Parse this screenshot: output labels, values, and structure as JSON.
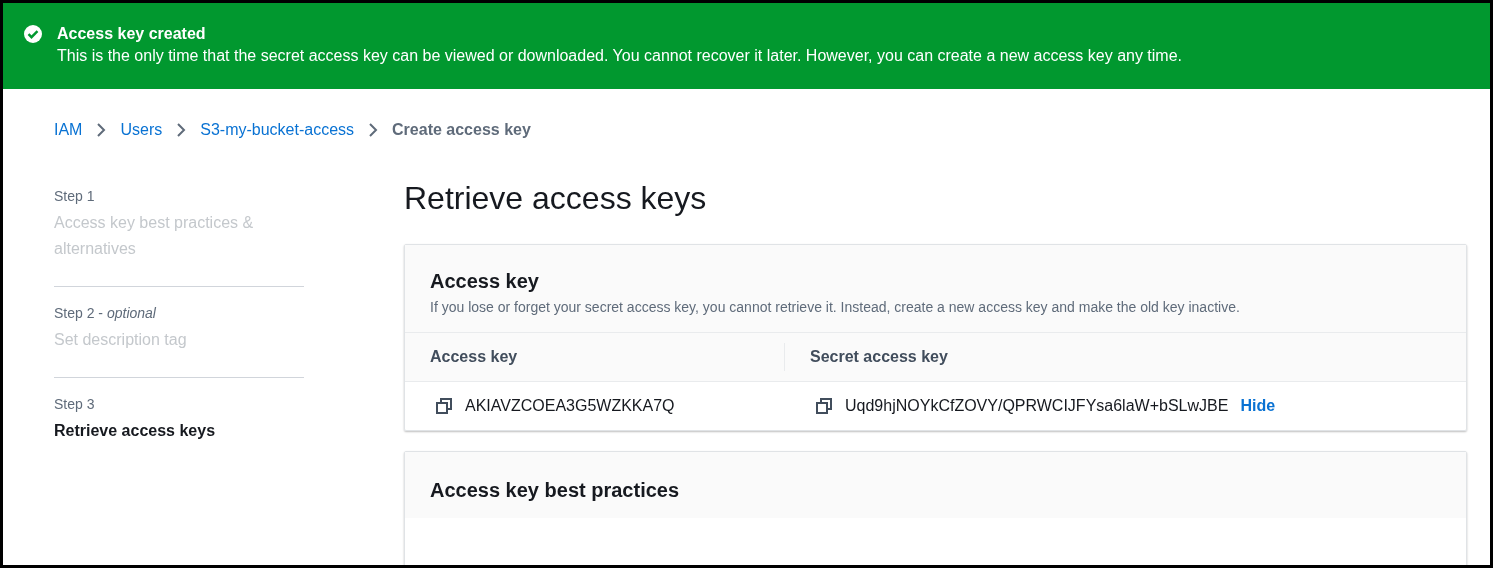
{
  "flash": {
    "title": "Access key created",
    "message": "This is the only time that the secret access key can be viewed or downloaded. You cannot recover it later. However, you can create a new access key any time."
  },
  "breadcrumbs": [
    {
      "label": "IAM",
      "current": false
    },
    {
      "label": "Users",
      "current": false
    },
    {
      "label": "S3-my-bucket-access",
      "current": false
    },
    {
      "label": "Create access key",
      "current": true
    }
  ],
  "steps": [
    {
      "label": "Step 1",
      "title": "Access key best practices & alternatives",
      "selected": false
    },
    {
      "label": "Step 2 - *optional*",
      "title": "Set description tag",
      "selected": false
    },
    {
      "label": "Step 3",
      "title": "Retrieve access keys",
      "selected": true
    }
  ],
  "page_title": "Retrieve access keys",
  "access_key_panel": {
    "title": "Access key",
    "description": "If you lose or forget your secret access key, you cannot retrieve it. Instead, create a new access key and make the old key inactive.",
    "columns": [
      "Access key",
      "Secret access key"
    ],
    "row": {
      "access_key": "AKIAVZCOEA3G5WZKKA7Q",
      "secret": "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",
      "toggle": "Hide"
    }
  },
  "best_practices_panel": {
    "title": "Access key best practices"
  }
}
